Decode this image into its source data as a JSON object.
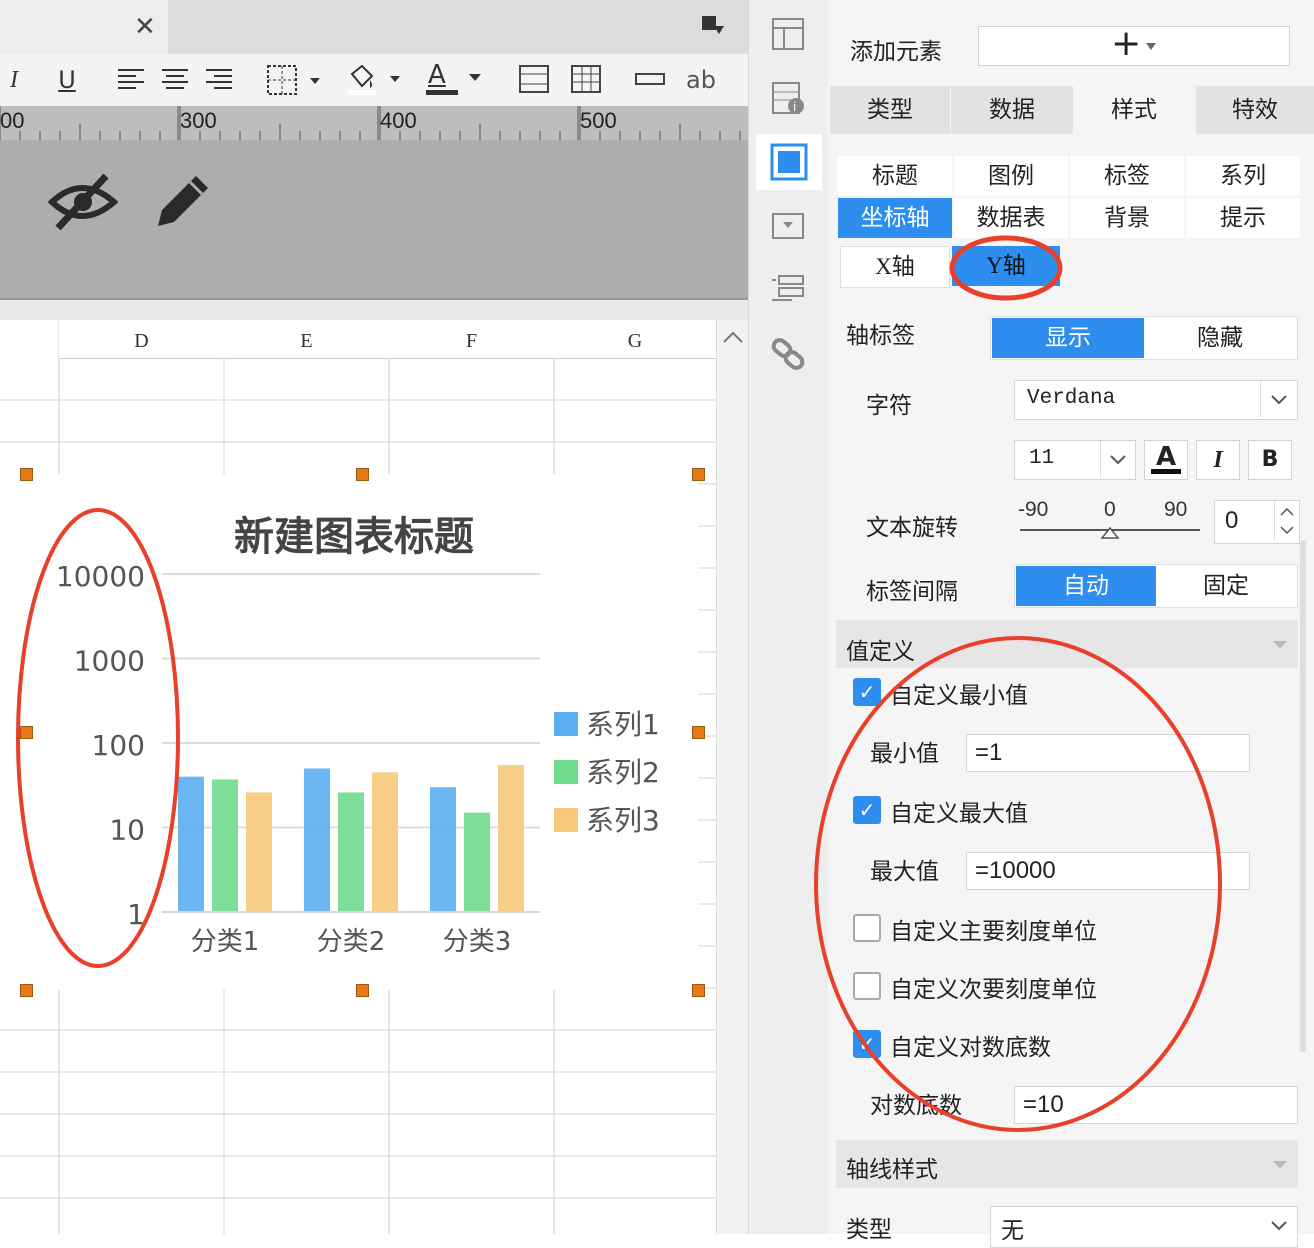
{
  "toolbar": {
    "italic": "I",
    "underline": "U",
    "text_abbr": "ab",
    "font_color_glyph": "A"
  },
  "ruler": {
    "marks": [
      "00",
      "300",
      "400",
      "500"
    ]
  },
  "columns": [
    "D",
    "E",
    "F",
    "G"
  ],
  "chart": {
    "title": "新建图表标题"
  },
  "chart_data": {
    "type": "bar",
    "title": "新建图表标题",
    "categories": [
      "分类1",
      "分类2",
      "分类3"
    ],
    "y_scale": "log",
    "log_base": 10,
    "ylim": [
      1,
      10000
    ],
    "y_ticks": [
      "10000",
      "1000",
      "100",
      "10",
      "1"
    ],
    "series": [
      {
        "name": "系列1",
        "values": [
          40,
          50,
          30
        ],
        "color": "#5aaff2"
      },
      {
        "name": "系列2",
        "values": [
          37,
          26,
          15
        ],
        "color": "#6fdc8c"
      },
      {
        "name": "系列3",
        "values": [
          26,
          45,
          55
        ],
        "color": "#f7c97a"
      }
    ],
    "legend_position": "right",
    "grid": true
  },
  "panel": {
    "add_element": "添加元素",
    "main_tabs": [
      "类型",
      "数据",
      "样式",
      "特效"
    ],
    "sub_tabs_row1": [
      "标题",
      "图例",
      "标签",
      "系列"
    ],
    "sub_tabs_row2": [
      "坐标轴",
      "数据表",
      "背景",
      "提示"
    ],
    "axis_tabs": [
      "X轴",
      "Y轴"
    ],
    "axis_label": {
      "label": "轴标签",
      "show": "显示",
      "hide": "隐藏"
    },
    "font": {
      "label": "字符",
      "family": "Verdana",
      "size": "11",
      "bold": "B",
      "italic": "I",
      "color_glyph": "A"
    },
    "rotation": {
      "label": "文本旋转",
      "min": "-90",
      "mid": "0",
      "max": "90",
      "value": "0"
    },
    "interval": {
      "label": "标签间隔",
      "auto": "自动",
      "fixed": "固定"
    },
    "value_def": {
      "section": "值定义",
      "custom_min": "自定义最小值",
      "min_label": "最小值",
      "min_value": "=1",
      "custom_max": "自定义最大值",
      "max_label": "最大值",
      "max_value": "=10000",
      "custom_major": "自定义主要刻度单位",
      "custom_minor": "自定义次要刻度单位",
      "custom_log": "自定义对数底数",
      "log_label": "对数底数",
      "log_value": "=10"
    },
    "axis_line": {
      "section": "轴线样式",
      "type_label": "类型",
      "type_value": "无"
    }
  },
  "colors": {
    "accent": "#2d8ef0",
    "annotation": "#e8402a"
  }
}
